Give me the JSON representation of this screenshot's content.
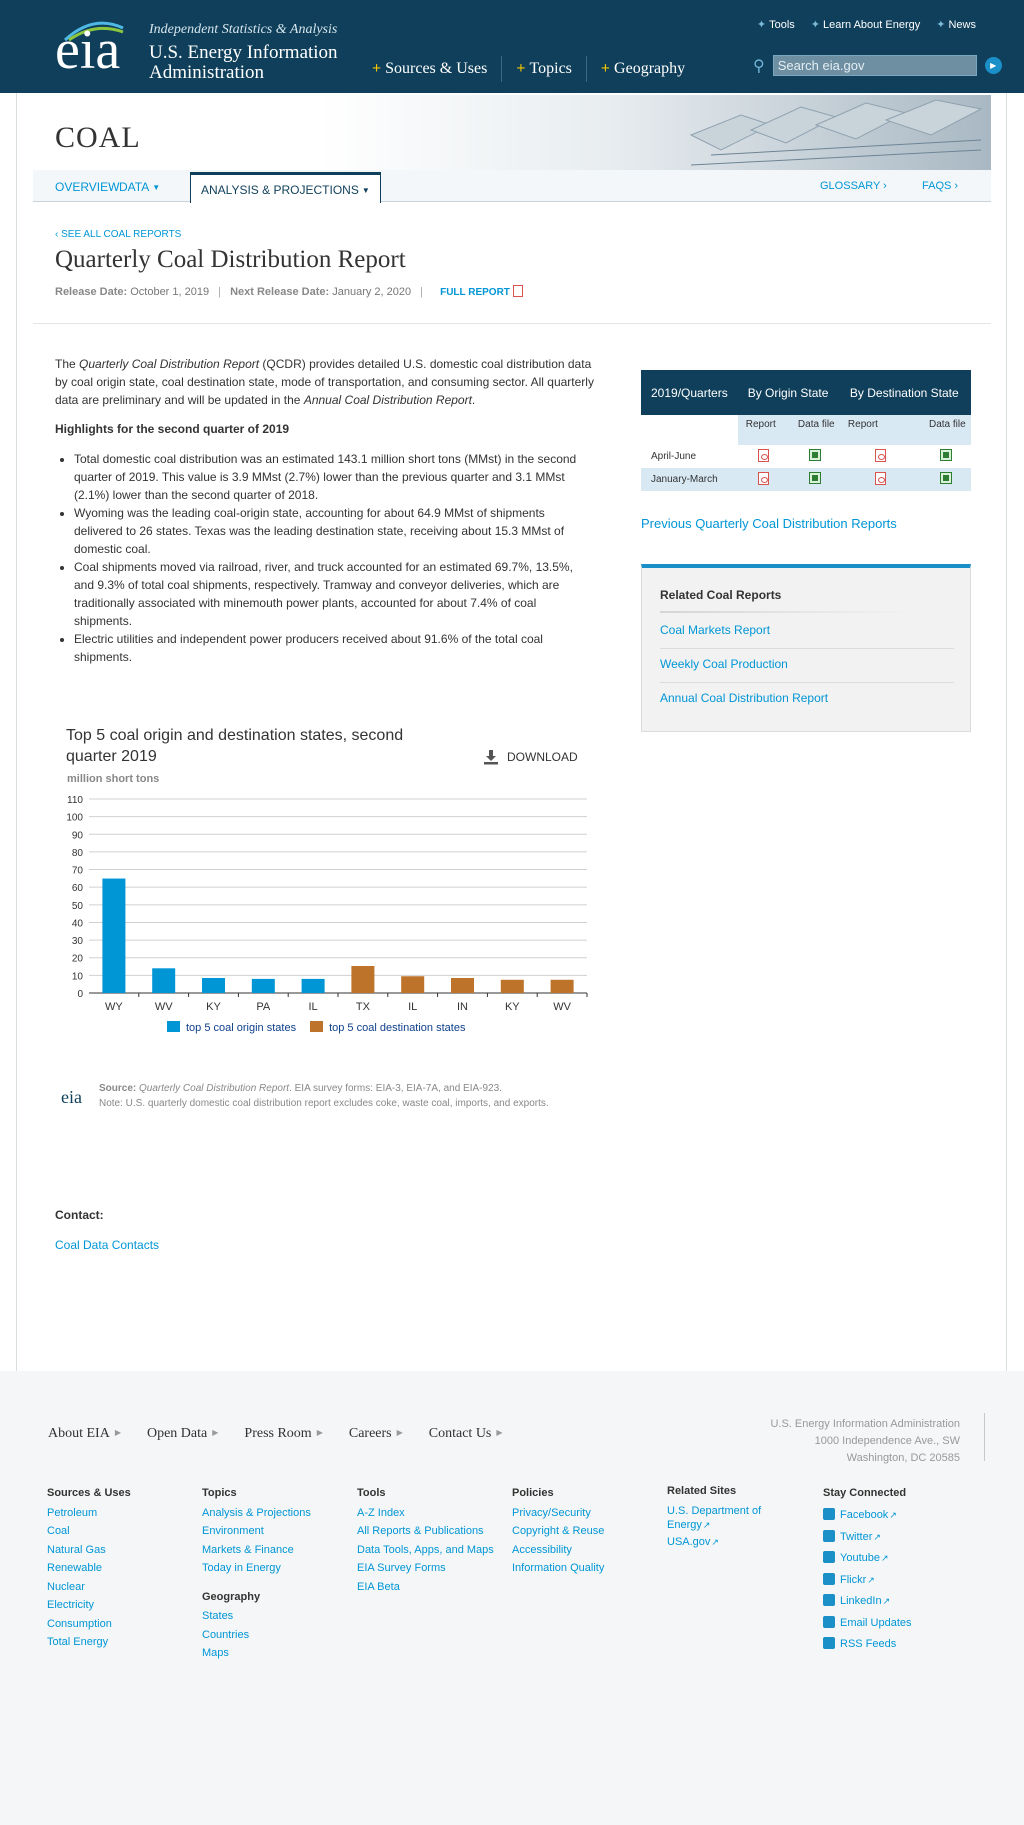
{
  "header": {
    "logo_text": "eia",
    "tagline": "Independent Statistics & Analysis",
    "agency_line1": "U.S. Energy Information",
    "agency_line2": "Administration",
    "top_links": [
      "Tools",
      "Learn About Energy",
      "News"
    ],
    "main_nav": [
      "Sources & Uses",
      "Topics",
      "Geography"
    ],
    "search_placeholder": "Search eia.gov"
  },
  "banner": {
    "title": "COAL"
  },
  "subnav": {
    "overview": "OVERVIEW",
    "data": "DATA",
    "analysis": "ANALYSIS & PROJECTIONS",
    "glossary": "GLOSSARY ›",
    "faqs": "FAQS ›"
  },
  "page": {
    "see_all": "‹ SEE ALL COAL REPORTS",
    "title": "Quarterly Coal Distribution Report",
    "release_label": "Release Date:",
    "release_date": "October 1, 2019",
    "next_release_label": "Next Release Date:",
    "next_release_date": "January 2, 2020",
    "full_report": "FULL REPORT"
  },
  "intro": {
    "p1": "The ",
    "p1_italic": "Quarterly Coal Distribution Report",
    "p2": " (QCDR) provides detailed U.S. domestic coal distribution data by coal origin state, coal destination state, mode of transportation, and consuming sector. All quarterly data are preliminary and will be updated in the ",
    "p2_italic": "Annual Coal Distribution Report",
    "p3": "."
  },
  "highlights": {
    "title": "Highlights for the second quarter of 2019",
    "items": [
      "Total domestic coal distribution was an estimated 143.1 million short tons (MMst) in the second quarter of 2019. This value is 3.9 MMst (2.7%) lower than the previous quarter and 3.1 MMst (2.1%) lower than the second quarter of 2018.",
      "Wyoming was the leading coal-origin state, accounting for about 64.9 MMst of shipments delivered to 26 states. Texas was the leading destination state, receiving about 15.3 MMst of domestic coal.",
      "Coal shipments moved via railroad, river, and truck accounted for an estimated 69.7%, 13.5%, and 9.3% of total coal shipments, respectively. Tramway and conveyor deliveries, which are traditionally associated with minemouth power plants, accounted for about 7.4% of coal shipments.",
      "Electric utilities and independent power producers received about 91.6% of the total coal shipments."
    ]
  },
  "table": {
    "col0": "2019/Quarters",
    "col1": "By Origin State",
    "col2": "By Destination State",
    "sub_report": "Report",
    "sub_datafile": "Data file",
    "rows": [
      "April-June",
      "January-March"
    ]
  },
  "prev_link": "Previous Quarterly Coal Distribution Reports",
  "related": {
    "title": "Related Coal Reports",
    "links": [
      "Coal Markets Report",
      "Weekly Coal Production",
      "Annual Coal Distribution Report"
    ]
  },
  "chart_data": {
    "type": "bar",
    "title": "Top 5 coal origin and destination states, second quarter 2019",
    "ylabel": "million short tons",
    "download": "DOWNLOAD",
    "ylim": [
      0,
      110
    ],
    "yticks": [
      0,
      10,
      20,
      30,
      40,
      50,
      60,
      70,
      80,
      90,
      100,
      110
    ],
    "categories": [
      "WY",
      "WV",
      "KY",
      "PA",
      "IL",
      "TX",
      "IL",
      "IN",
      "KY",
      "WV"
    ],
    "values": [
      64.9,
      14.0,
      8.5,
      8.0,
      8.0,
      15.3,
      9.5,
      8.5,
      7.5,
      7.5
    ],
    "groups": [
      "origin",
      "origin",
      "origin",
      "origin",
      "origin",
      "destination",
      "destination",
      "destination",
      "destination",
      "destination"
    ],
    "series": [
      {
        "name": "top 5 coal origin states",
        "color": "#0096d6"
      },
      {
        "name": "top 5 coal destination states",
        "color": "#bd732a"
      }
    ],
    "grid": true,
    "legend": "bottom"
  },
  "source": {
    "label": "Source:",
    "italic": "Quarterly Coal Distribution Report",
    "rest": ". EIA survey forms: EIA-3, EIA-7A, and EIA-923.",
    "note": "Note: U.S. quarterly domestic coal distribution report excludes coke, waste coal, imports, and exports.",
    "logo": "eia"
  },
  "contact": {
    "label": "Contact:",
    "link": "Coal Data Contacts"
  },
  "footer": {
    "nav": [
      "About EIA",
      "Open Data",
      "Press Room",
      "Careers",
      "Contact Us"
    ],
    "address": [
      "U.S. Energy Information Administration",
      "1000 Independence Ave., SW",
      "Washington, DC 20585"
    ],
    "columns": [
      {
        "heading": "Sources & Uses",
        "links": [
          "Petroleum",
          "Coal",
          "Natural Gas",
          "Renewable",
          "Nuclear",
          "Electricity",
          "Consumption",
          "Total Energy"
        ]
      },
      {
        "heading": "Topics",
        "links": [
          "Analysis & Projections",
          "Environment",
          "Markets & Finance",
          "Today in Energy"
        ]
      },
      {
        "heading": "Geography",
        "links": [
          "States",
          "Countries",
          "Maps"
        ]
      },
      {
        "heading": "Tools",
        "links": [
          "A-Z Index",
          "All Reports & Publications",
          "Data Tools, Apps, and Maps",
          "EIA Survey Forms",
          "EIA Beta"
        ]
      },
      {
        "heading": "Policies",
        "links": [
          "Privacy/Security",
          "Copyright & Reuse",
          "Accessibility",
          "Information Quality"
        ]
      },
      {
        "heading": "Related Sites",
        "links": [
          "U.S. Department of Energy",
          "USA.gov"
        ]
      },
      {
        "heading": "Stay Connected",
        "links": [
          "Facebook",
          "Twitter",
          "Youtube",
          "Flickr",
          "LinkedIn",
          "Email Updates",
          "RSS Feeds"
        ]
      }
    ]
  }
}
